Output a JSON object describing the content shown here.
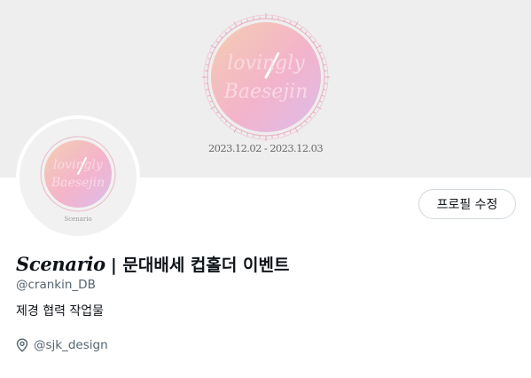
{
  "banner": {
    "art_text_line1": "lovingly",
    "art_text_line2": "Baesejin",
    "date_range": "2023.12.02 - 2023.12.03"
  },
  "avatar": {
    "art_text_line1": "lovingly",
    "art_text_line2": "Baesejin",
    "caption": "Scenario"
  },
  "actions": {
    "edit_profile_label": "프로필 수정"
  },
  "profile": {
    "name_script": "Scenario",
    "name_rest": "| 문대배세 컵홀더 이벤트",
    "handle": "@crankin_DB",
    "bio": "제경 협력 작업물",
    "location_icon": "location-pin-icon",
    "location_text": "@sjk_design"
  },
  "colors": {
    "banner_bg": "#eeeeee",
    "clock_pink": "#f4a9c4",
    "clock_peach": "#f6c7a6",
    "clock_lilac": "#d9b3ea",
    "text_primary": "#0f1419",
    "text_secondary": "#536471",
    "border": "#cfd9de"
  }
}
